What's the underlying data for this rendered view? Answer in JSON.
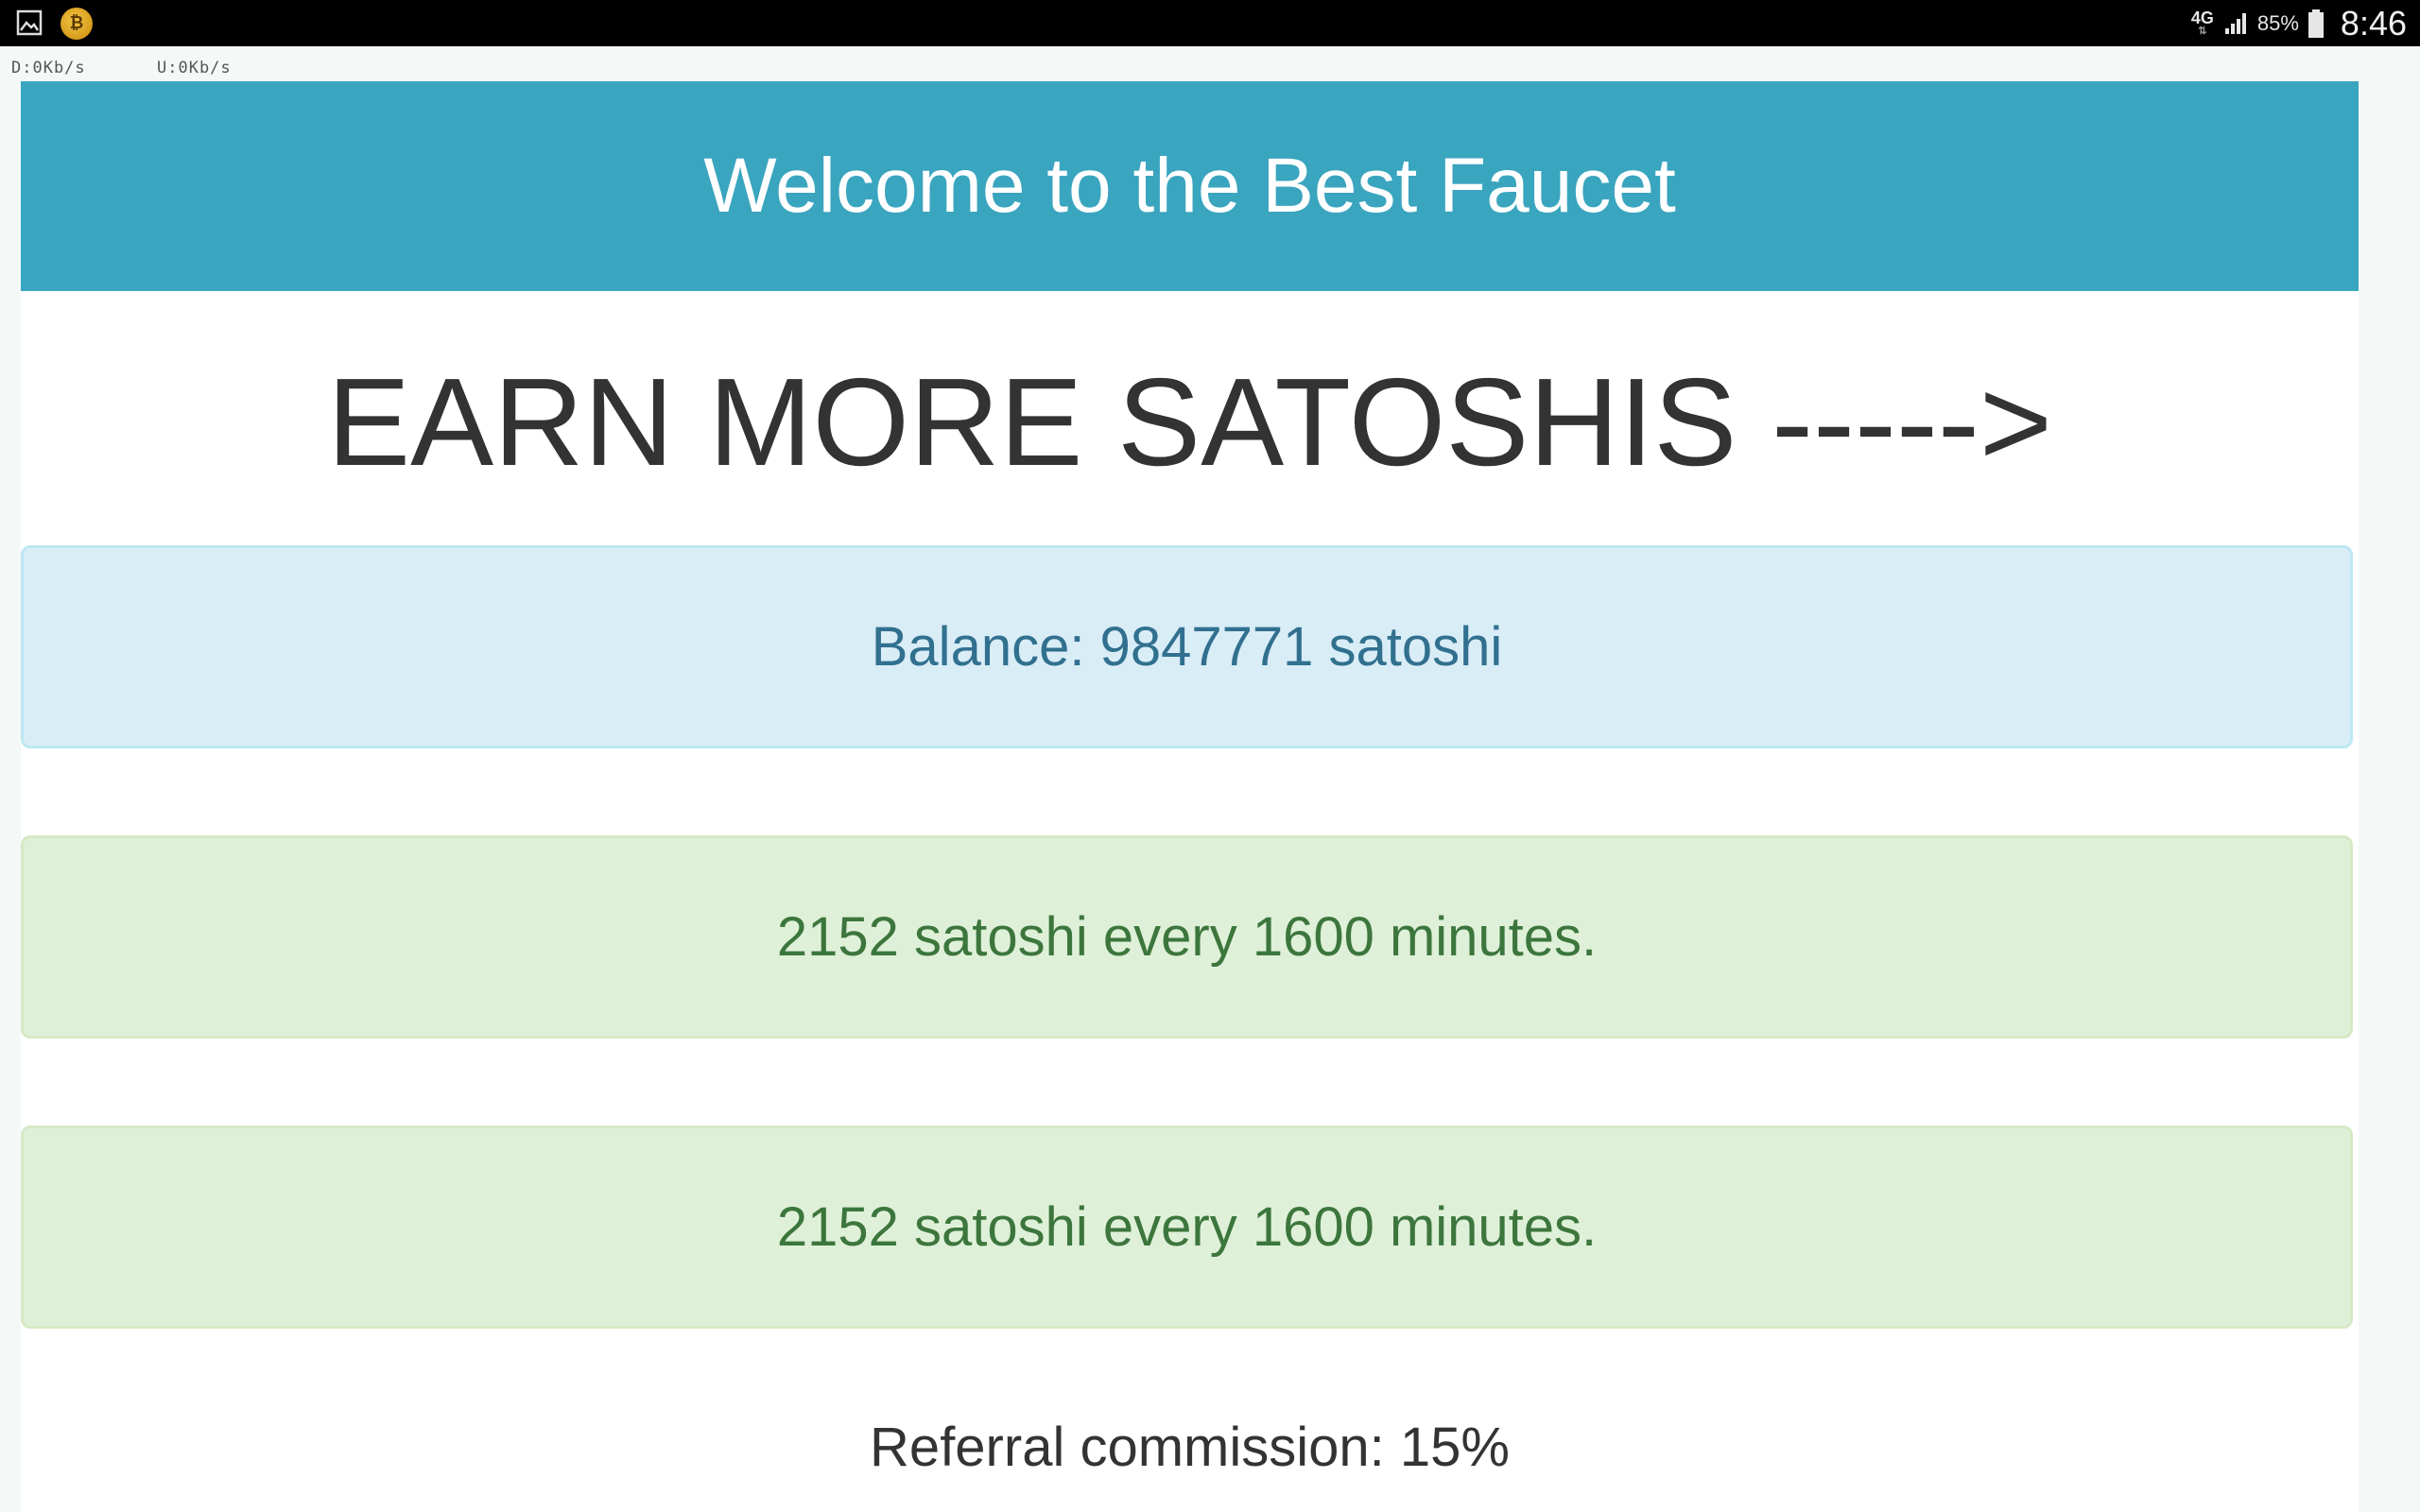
{
  "status_bar": {
    "network_type": "4G",
    "battery_percent": "85%",
    "time": "8:46",
    "download_speed": "D:0Kb/s",
    "upload_speed": "U:0Kb/s"
  },
  "page": {
    "welcome_title": "Welcome to the Best Faucet",
    "earn_heading": "EARN MORE SATOSHIS ----->",
    "balance_text": "Balance: 9847771 satoshi",
    "reward_alerts": [
      "2152 satoshi every 1600 minutes.",
      "2152 satoshi every 1600 minutes."
    ],
    "referral_commission": "Referral commission: 15%"
  },
  "colors": {
    "banner": "#3aa5bf",
    "info_bg": "#d9edf7",
    "info_text": "#31708f",
    "success_bg": "#dff0d8",
    "success_text": "#3c763d"
  }
}
